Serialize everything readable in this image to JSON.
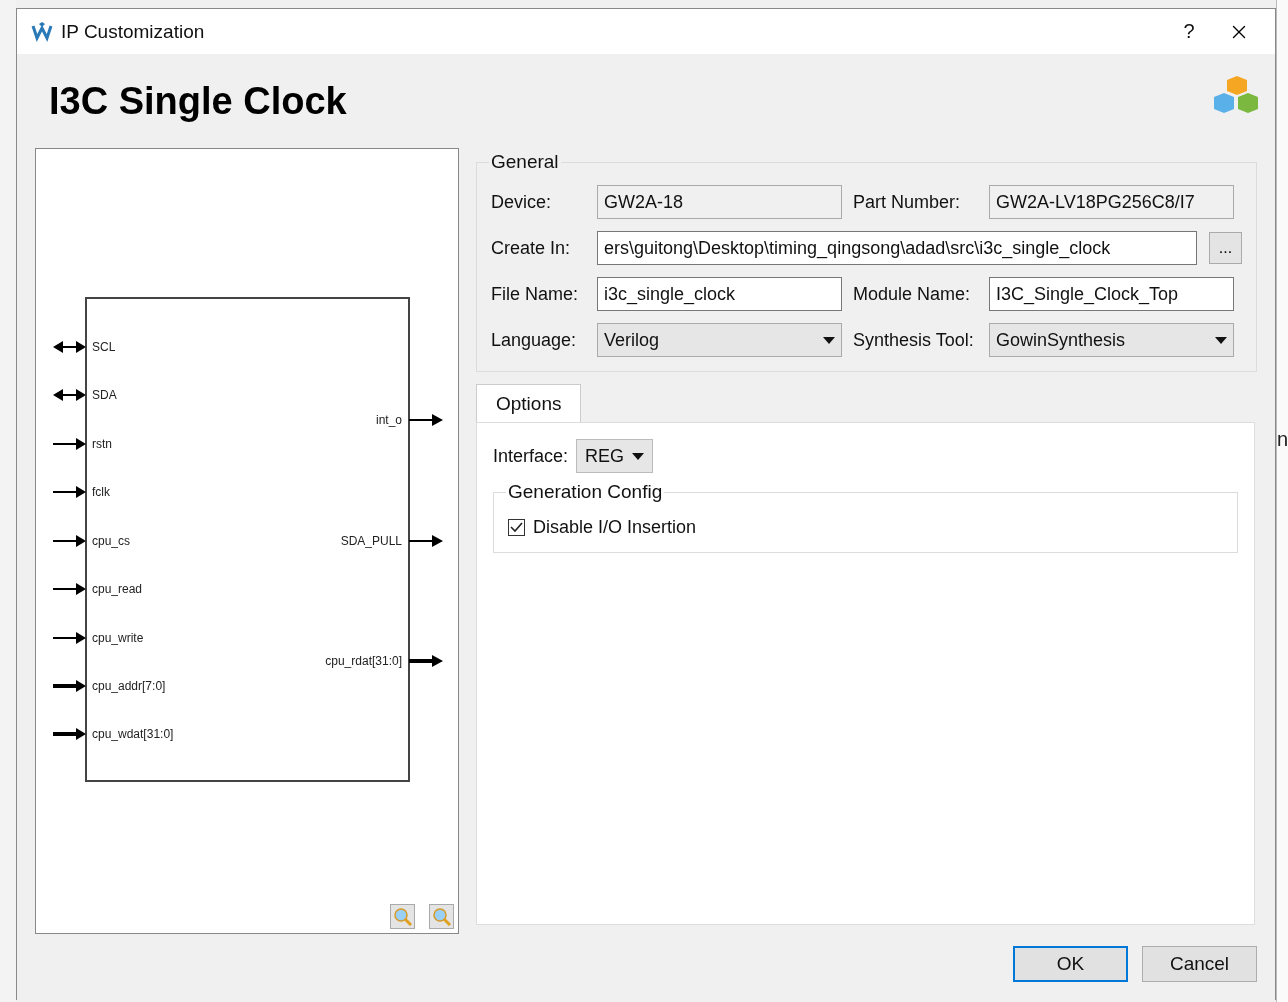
{
  "window": {
    "title": "IP Customization",
    "help": "?"
  },
  "heading": "I3C Single Clock",
  "diagram": {
    "left_pins": [
      {
        "name": "SCL",
        "kind": "inout"
      },
      {
        "name": "SDA",
        "kind": "inout"
      },
      {
        "name": "rstn",
        "kind": "input"
      },
      {
        "name": "fclk",
        "kind": "input"
      },
      {
        "name": "cpu_cs",
        "kind": "input"
      },
      {
        "name": "cpu_read",
        "kind": "input"
      },
      {
        "name": "cpu_write",
        "kind": "input"
      },
      {
        "name": "cpu_addr[7:0]",
        "kind": "bus"
      },
      {
        "name": "cpu_wdat[31:0]",
        "kind": "bus"
      }
    ],
    "right_pins": [
      {
        "name": "int_o",
        "kind": "output"
      },
      {
        "name": "SDA_PULL",
        "kind": "output"
      },
      {
        "name": "cpu_rdat[31:0]",
        "kind": "bus"
      }
    ]
  },
  "general": {
    "title": "General",
    "rows": [
      [
        {
          "label": "Device:",
          "kind": "readonly",
          "value": "GW2A-18"
        },
        {
          "label": "Part Number:",
          "kind": "readonly",
          "value": "GW2A-LV18PG256C8/I7"
        }
      ],
      [
        {
          "label": "Create In:",
          "kind": "path",
          "value": "ers\\guitong\\Desktop\\timing_qingsong\\adad\\src\\i3c_single_clock",
          "button": "..."
        }
      ],
      [
        {
          "label": "File Name:",
          "kind": "text",
          "value": "i3c_single_clock"
        },
        {
          "label": "Module Name:",
          "kind": "text",
          "value": "I3C_Single_Clock_Top"
        }
      ],
      [
        {
          "label": "Language:",
          "kind": "select",
          "value": "Verilog"
        },
        {
          "label": "Synthesis Tool:",
          "kind": "select",
          "value": "GowinSynthesis"
        }
      ]
    ]
  },
  "options": {
    "tab": "Options",
    "interface": {
      "label": "Interface:",
      "value": "REG"
    },
    "generation": {
      "title": "Generation Config",
      "checkbox": {
        "label": "Disable I/O Insertion",
        "checked": true
      }
    }
  },
  "buttons": [
    {
      "label": "OK",
      "default": true
    },
    {
      "label": "Cancel",
      "default": false
    }
  ],
  "background": {
    "fragment": "n"
  }
}
